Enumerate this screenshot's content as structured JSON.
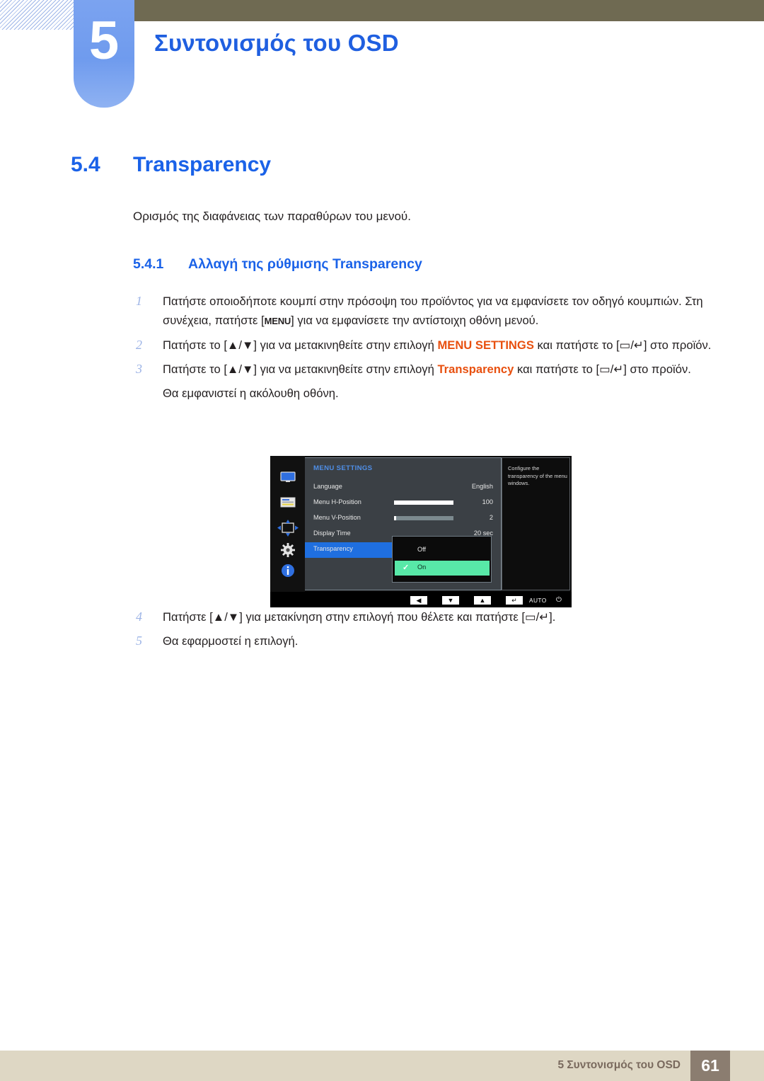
{
  "header": {
    "chapter_number": "5",
    "chapter_title": "Συντονισμός του OSD"
  },
  "section": {
    "number": "5.4",
    "title": "Transparency",
    "intro": "Ορισμός της διαφάνειας των παραθύρων του μενού.",
    "subsection_number": "5.4.1",
    "subsection_title": "Αλλαγή της ρύθμισης Transparency"
  },
  "steps": [
    {
      "index": "1",
      "text_a": "Πατήστε οποιοδήποτε κουμπί στην πρόσοψη του προϊόντος για να εμφανίσετε τον οδηγό κουμπιών. Στη συνέχεια, πατήστε [",
      "kbd": "MENU",
      "text_b": "] για να εμφανίσετε την αντίστοιχη οθόνη μενού."
    },
    {
      "index": "2",
      "text_a": "Πατήστε το [▲/▼] για να μετακινηθείτε στην επιλογή ",
      "highlight": "MENU SETTINGS",
      "text_b": " και πατήστε το [▭/↵] στο προϊόν."
    },
    {
      "index": "3",
      "text_a": "Πατήστε το [▲/▼] για να μετακινηθείτε στην επιλογή ",
      "highlight": "Transparency",
      "text_b": " και πατήστε το [▭/↵] στο προϊόν."
    }
  ],
  "note_after_step3": "Θα εμφανιστεί η ακόλουθη οθόνη.",
  "steps_late": [
    {
      "index": "4",
      "text": "Πατήστε [▲/▼] για μετακίνηση στην επιλογή που θέλετε και πατήστε [▭/↵]."
    },
    {
      "index": "5",
      "text": "Θα εφαρμοστεί η επιλογή."
    }
  ],
  "osd": {
    "title": "MENU SETTINGS",
    "help_text": "Configure the transparency of the menu windows.",
    "sidebar_icons": [
      "monitor-icon",
      "picture-icon",
      "position-arrows-icon",
      "gear-icon",
      "info-icon"
    ],
    "rows": [
      {
        "label": "Language",
        "value": "English",
        "bar": "none"
      },
      {
        "label": "Menu H-Position",
        "value": "100",
        "bar": "full"
      },
      {
        "label": "Menu V-Position",
        "value": "2",
        "bar": "track"
      },
      {
        "label": "Display Time",
        "value": "20 sec",
        "bar": "none"
      },
      {
        "label": "Transparency",
        "value": "",
        "bar": "none"
      }
    ],
    "dropdown": {
      "options": [
        "Off",
        "On"
      ],
      "selected": "On",
      "check_glyph": "✓"
    },
    "button_bar": {
      "buttons": [
        "◀",
        "▼",
        "▲",
        "↵"
      ],
      "auto_label": "AUTO",
      "power_glyph": "⏻"
    }
  },
  "footer": {
    "text": "5 Συντονισμός του OSD",
    "page": "61"
  }
}
